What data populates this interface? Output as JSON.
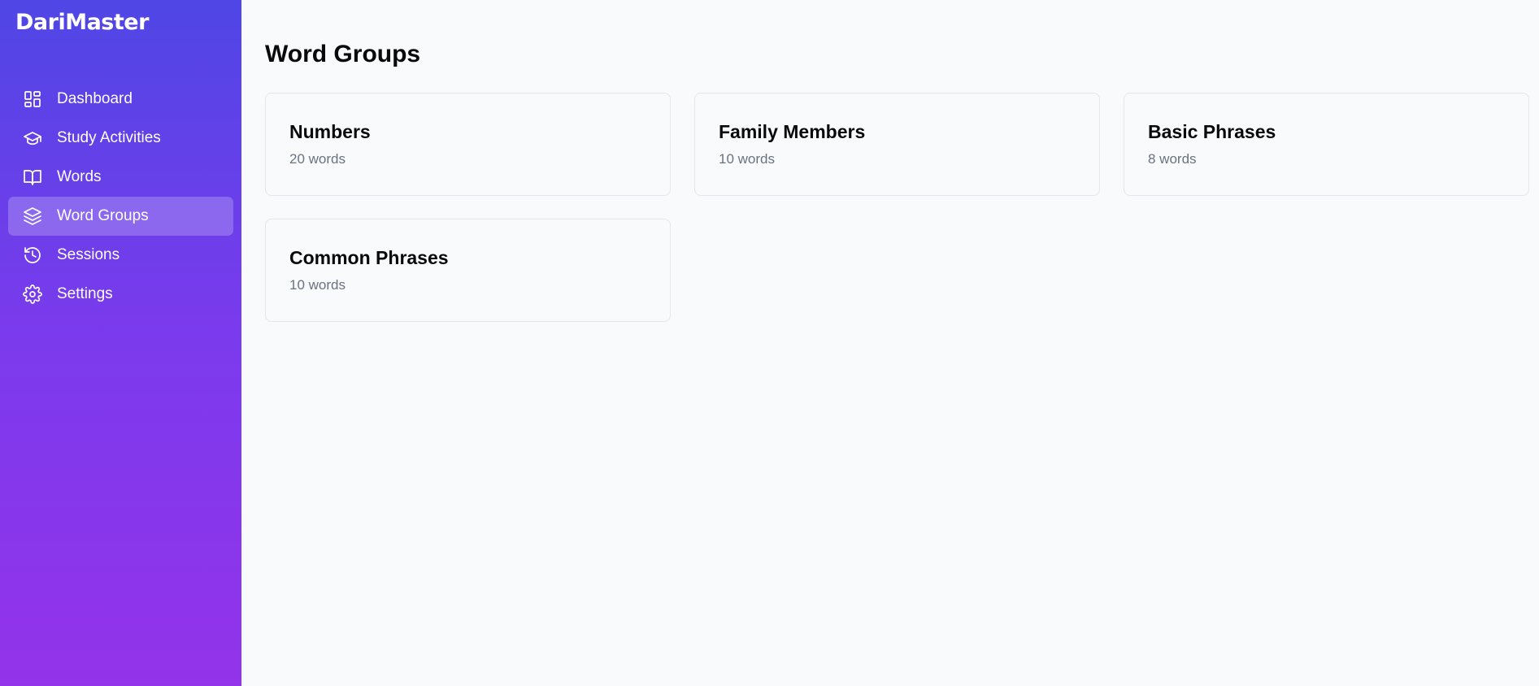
{
  "app": {
    "logo": "DariMaster"
  },
  "sidebar": {
    "items": [
      {
        "label": "Dashboard",
        "icon": "dashboard-icon",
        "active": false
      },
      {
        "label": "Study Activities",
        "icon": "graduation-cap-icon",
        "active": false
      },
      {
        "label": "Words",
        "icon": "book-open-icon",
        "active": false
      },
      {
        "label": "Word Groups",
        "icon": "layers-icon",
        "active": true
      },
      {
        "label": "Sessions",
        "icon": "history-icon",
        "active": false
      },
      {
        "label": "Settings",
        "icon": "gear-icon",
        "active": false
      }
    ]
  },
  "main": {
    "title": "Word Groups",
    "groups": [
      {
        "name": "Numbers",
        "count": "20 words"
      },
      {
        "name": "Family Members",
        "count": "10 words"
      },
      {
        "name": "Basic Phrases",
        "count": "8 words"
      },
      {
        "name": "Common Phrases",
        "count": "10 words"
      }
    ]
  },
  "colors": {
    "sidebar_gradient_start": "#4f46e5",
    "sidebar_gradient_end": "#9333ea",
    "page_background": "#f8fafc",
    "card_border": "#e2e8f0",
    "muted_text": "#6b7280"
  }
}
